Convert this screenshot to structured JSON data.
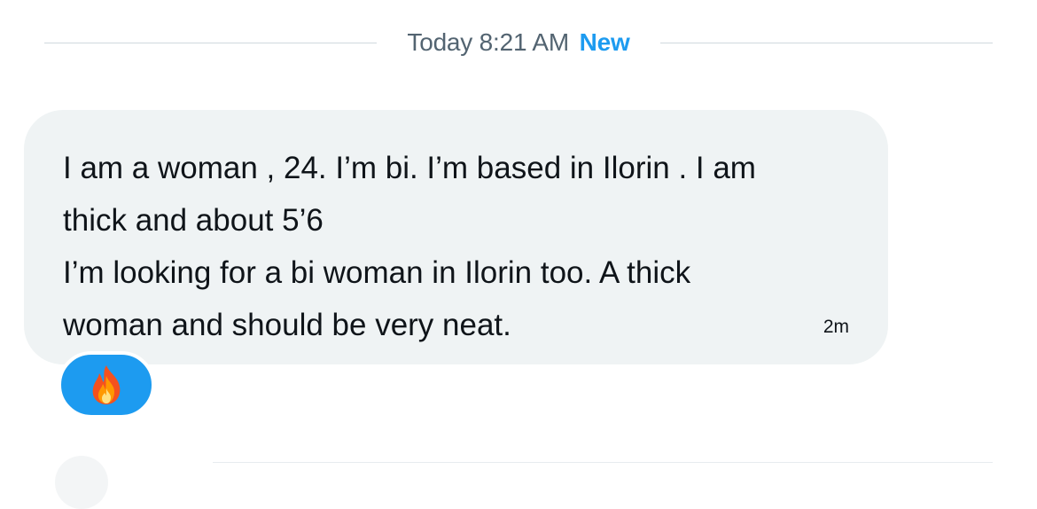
{
  "divider": {
    "timestamp": "Today 8:21 AM",
    "new_label": "New"
  },
  "message": {
    "text": "I am a woman , 24. I’m bi. I’m based in Ilorin . I am thick and about 5’6\nI’m looking for a bi woman in Ilorin too. A thick woman and should be very neat.",
    "time": "2m"
  },
  "reaction": {
    "icon": "fire-emoji-icon"
  },
  "colors": {
    "accent": "#1d9bf0",
    "bubble_bg": "#eff3f4",
    "muted_text": "#536471",
    "text": "#0f1419"
  }
}
